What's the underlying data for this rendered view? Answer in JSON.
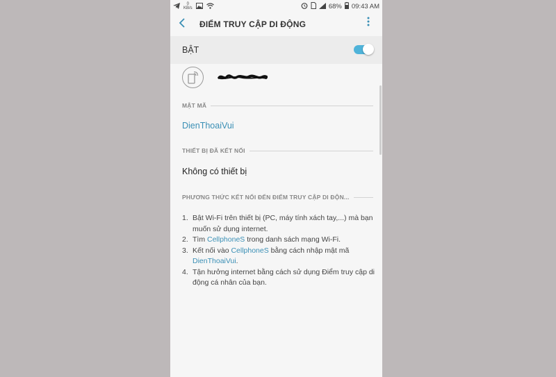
{
  "status_bar": {
    "time": "09:43 AM",
    "battery": "68%",
    "data_rate_top": "0",
    "data_rate_bottom": "KB/s"
  },
  "header": {
    "title": "ĐIỂM TRUY CẬP DI ĐỘNG"
  },
  "switch": {
    "label": "BẬT",
    "state": "on"
  },
  "sections": {
    "password_header": "MẬT MÃ",
    "password_value": "DienThoaiVui",
    "devices_header": "THIẾT BỊ ĐÃ KẾT NỐI",
    "devices_value": "Không có thiết bị",
    "method_header": "PHƯƠNG THỨC KẾT NỐI ĐẾN ĐIỂM TRUY CẬP DI ĐỘN..."
  },
  "steps": [
    {
      "num": "1.",
      "text": "Bật Wi-Fi trên thiết bị (PC, máy tính xách tay,...) mà bạn muốn sử dụng internet."
    },
    {
      "num": "2.",
      "pre": "Tìm ",
      "hl": "CellphoneS",
      "post": " trong danh sách mạng Wi-Fi."
    },
    {
      "num": "3.",
      "pre": "Kết nối vào ",
      "hl": "CellphoneS",
      "post": " bằng cách nhập mật mã ",
      "hl2": "DienThoaiVui",
      "post2": "."
    },
    {
      "num": "4.",
      "text": "Tận hưởng internet bằng cách sử dụng Điểm truy cập di động cá nhân của bạn."
    }
  ],
  "colors": {
    "accent": "#3a8fb5",
    "toggle_on": "#4fb3d9",
    "outer_background": "#bdb8b9"
  },
  "icons": [
    "telegram-icon",
    "image-icon",
    "wifi-icon",
    "alarm-icon",
    "signal-icon",
    "battery-icon",
    "back-arrow-icon",
    "more-vert-icon",
    "hotspot-icon"
  ]
}
